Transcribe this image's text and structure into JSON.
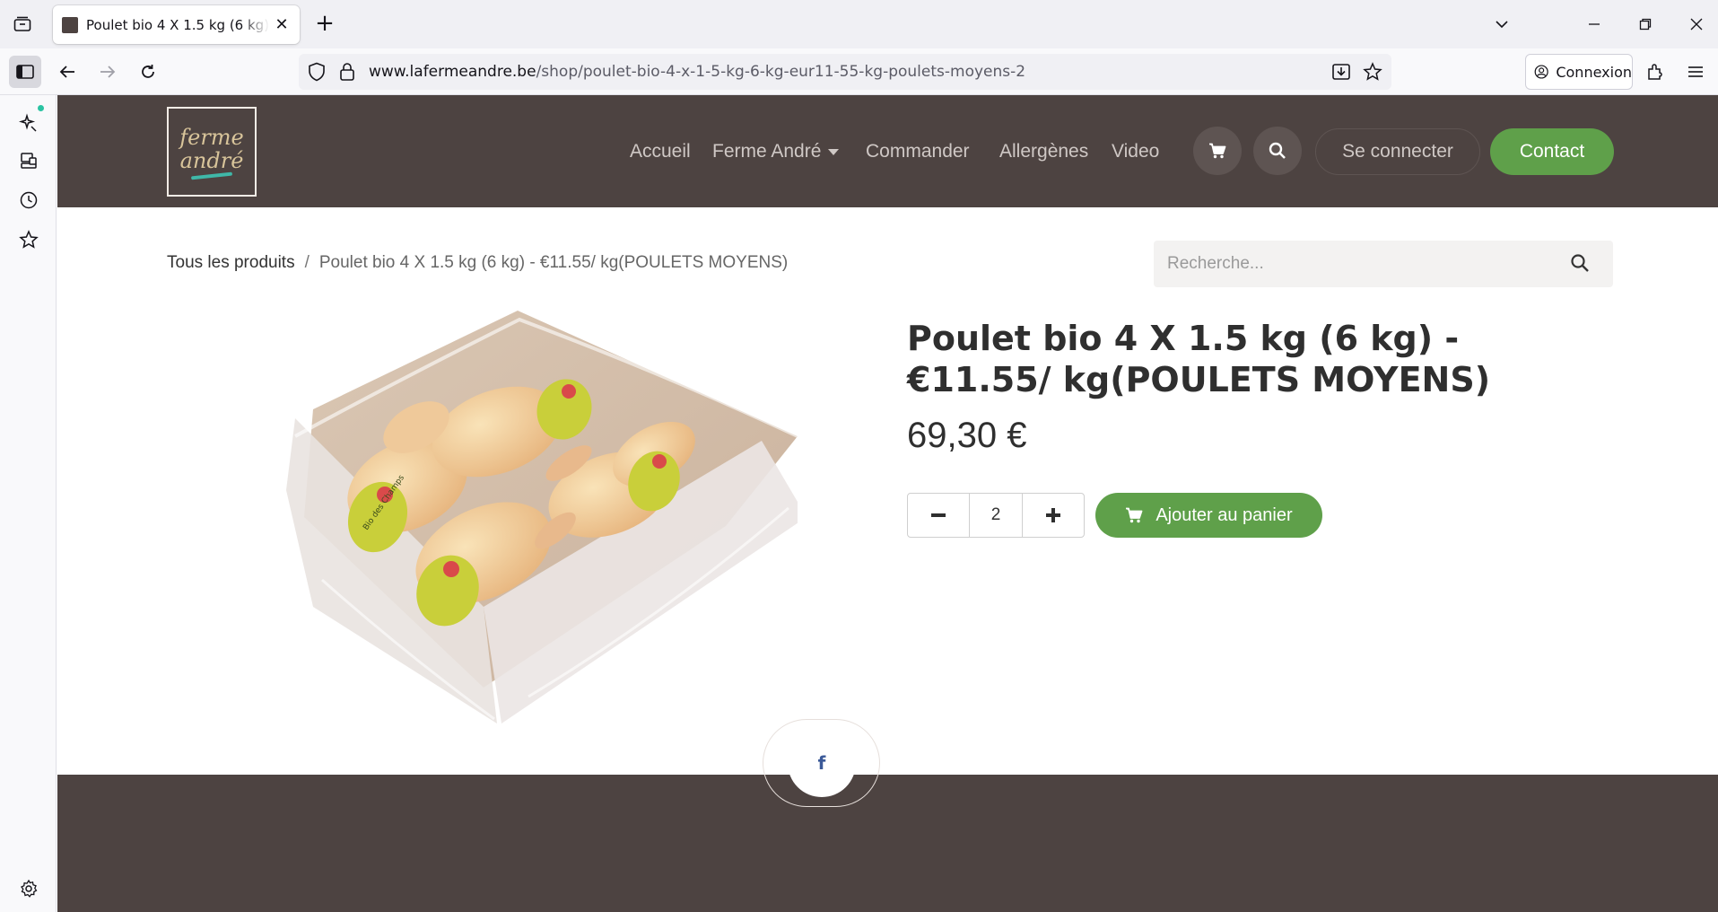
{
  "browser": {
    "tab_title": "Poulet bio 4 X 1.5 kg (6 kg) - €11.55/ kg(POULETS MOYENS)",
    "url_domain": "www.lafermeandre.be",
    "url_path": "/shop/poulet-bio-4-x-1-5-kg-6-kg-eur11-55-kg-poulets-moyens-2",
    "account_label": "Connexion"
  },
  "header": {
    "logo_line1": "ferme",
    "logo_line2": "andré",
    "menu": {
      "home": "Accueil",
      "farm": "Ferme André",
      "order": "Commander",
      "allergens": "Allergènes",
      "video": "Video"
    },
    "login_label": "Se connecter",
    "contact_label": "Contact"
  },
  "breadcrumb": {
    "all_products": "Tous les produits",
    "separator": "/",
    "current": "Poulet bio 4 X 1.5 kg (6 kg) - €11.55/ kg(POULETS MOYENS)"
  },
  "search": {
    "placeholder": "Recherche..."
  },
  "product": {
    "title": "Poulet bio 4 X 1.5 kg (6 kg) - €11.55/ kg(POULETS MOYENS)",
    "price": "69,30 €",
    "quantity": "2",
    "add_to_cart_label": "Ajouter au panier",
    "label_text": "Bio des Champs"
  },
  "footer": {
    "facebook_glyph": "f"
  },
  "colors": {
    "header_bg": "#4d4341",
    "accent_green": "#5fa04a"
  }
}
